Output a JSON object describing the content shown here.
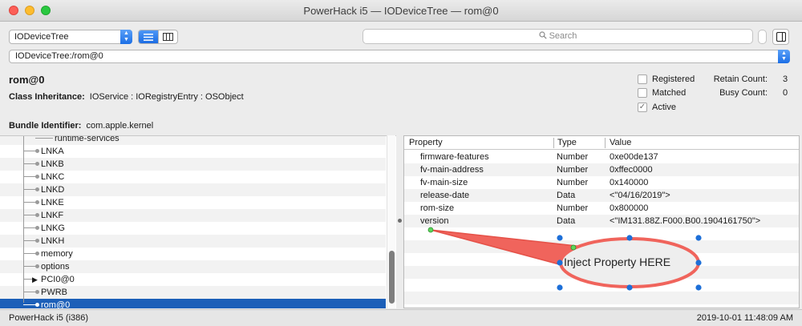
{
  "window": {
    "title": "PowerHack i5 — IODeviceTree — rom@0"
  },
  "toolbar": {
    "plane_value": "IODeviceTree",
    "view_modes": [
      "list-view-icon",
      "column-view-icon"
    ],
    "search_placeholder": "Search"
  },
  "path": {
    "value": "IODeviceTree:/rom@0"
  },
  "info": {
    "name": "rom@0",
    "class_label": "Class Inheritance:",
    "class_value": "IOService : IORegistryEntry : OSObject",
    "bundle_label": "Bundle Identifier:",
    "bundle_value": "com.apple.kernel"
  },
  "flags": [
    {
      "label": "Registered",
      "checked": false
    },
    {
      "label": "Matched",
      "checked": false
    },
    {
      "label": "Active",
      "checked": true
    }
  ],
  "counts": {
    "retain_label": "Retain Count:",
    "retain_value": "3",
    "busy_label": "Busy Count:",
    "busy_value": "0"
  },
  "tree": {
    "items": [
      {
        "label": "runtime-services"
      },
      {
        "label": "LNKA"
      },
      {
        "label": "LNKB"
      },
      {
        "label": "LNKC"
      },
      {
        "label": "LNKD"
      },
      {
        "label": "LNKE"
      },
      {
        "label": "LNKF"
      },
      {
        "label": "LNKG"
      },
      {
        "label": "LNKH"
      },
      {
        "label": "memory"
      },
      {
        "label": "options"
      },
      {
        "label": "PCI0@0",
        "expandable": true
      },
      {
        "label": "PWRB"
      },
      {
        "label": "rom@0",
        "selected": true
      }
    ]
  },
  "properties": {
    "columns": [
      "Property",
      "Type",
      "Value"
    ],
    "rows": [
      {
        "name": "firmware-features",
        "type": "Number",
        "value": "0xe00de137"
      },
      {
        "name": "fv-main-address",
        "type": "Number",
        "value": "0xffec0000"
      },
      {
        "name": "fv-main-size",
        "type": "Number",
        "value": "0x140000"
      },
      {
        "name": "release-date",
        "type": "Data",
        "value": "<\"04/16/2019\">"
      },
      {
        "name": "rom-size",
        "type": "Number",
        "value": "0x800000"
      },
      {
        "name": "version",
        "type": "Data",
        "value": "<\"IM131.88Z.F000.B00.1904161750\">"
      }
    ]
  },
  "annotation": {
    "text": "Inject Property HERE",
    "stroke": "#f0645c",
    "fill": "#eeeeee",
    "handle_color": "#1d6fd8"
  },
  "status": {
    "left": "PowerHack i5 (i386)",
    "right": "2019-10-01 11:48:09 AM"
  },
  "colors": {
    "selection": "#1c5fb8",
    "accent": "#1c6fe6"
  }
}
